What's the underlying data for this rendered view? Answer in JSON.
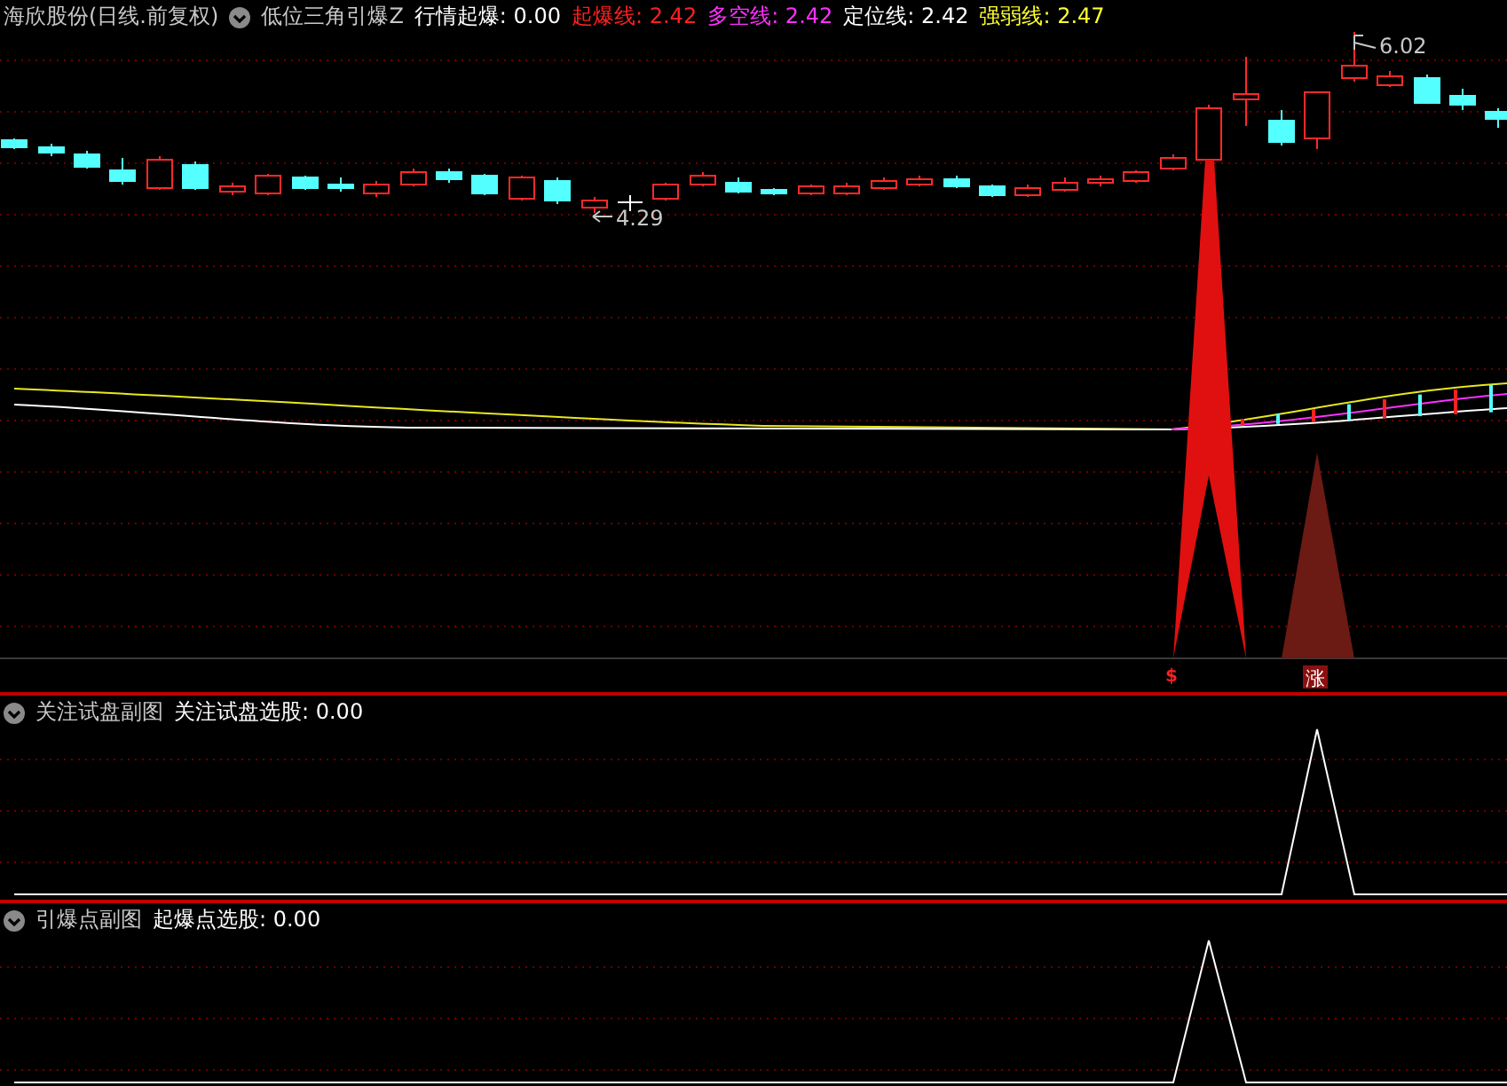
{
  "main": {
    "title": "海欣股份(日线.前复权)",
    "indicator": "低位三角引爆Z",
    "readings": [
      {
        "text": "行情起爆: 0.00",
        "color": "#ffffff"
      },
      {
        "text": "起爆线: 2.42",
        "color": "#ff2020"
      },
      {
        "text": "多空线: 2.42",
        "color": "#ff30ff"
      },
      {
        "text": "定位线: 2.42",
        "color": "#ffffff"
      },
      {
        "text": "强弱线: 2.47",
        "color": "#ffff30"
      }
    ],
    "high_label": "6.02",
    "low_label": "4.29",
    "markers": [
      {
        "kind": "dollar",
        "text": "$"
      },
      {
        "kind": "badge",
        "text": "涨"
      }
    ]
  },
  "panels": [
    {
      "title": "关注试盘副图",
      "reading": "关注试盘选股: 0.00"
    },
    {
      "title": "引爆点副图",
      "reading": "起爆点选股: 0.00"
    }
  ]
}
